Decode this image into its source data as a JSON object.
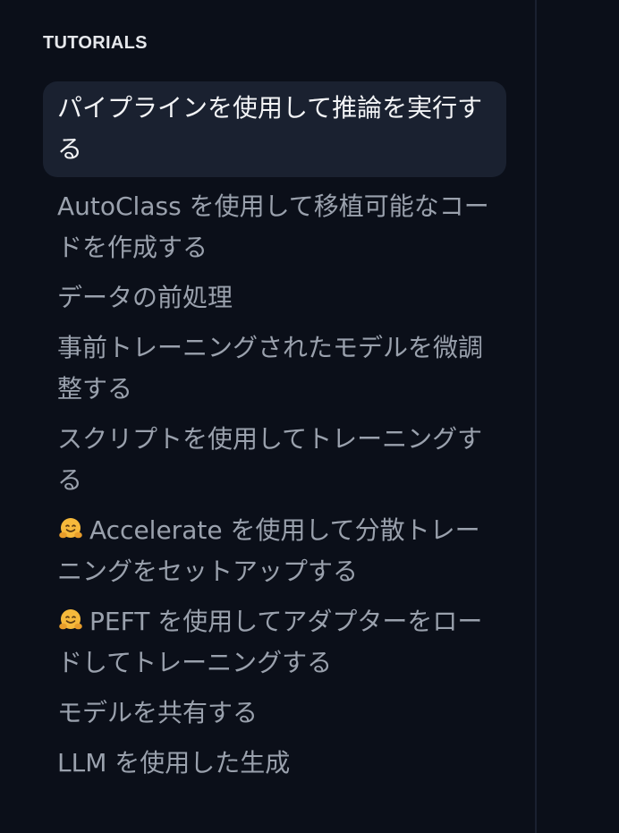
{
  "sidebar": {
    "section_title": "TUTORIALS",
    "items": [
      {
        "label": "パイプラインを使用して推論を実行する",
        "active": true
      },
      {
        "label": "AutoClass を使用して移植可能なコードを作成する",
        "active": false
      },
      {
        "label": "データの前処理",
        "active": false
      },
      {
        "label": "事前トレーニングされたモデルを微調整する",
        "active": false
      },
      {
        "label": "スクリプトを使用してトレーニングする",
        "active": false
      },
      {
        "label": "Accelerate を使用して分散トレーニングをセットアップする",
        "active": false,
        "icon": "hugging-face-emoji-icon"
      },
      {
        "label": "PEFT を使用してアダプターをロードしてトレーニングする",
        "active": false,
        "icon": "hugging-face-emoji-icon"
      },
      {
        "label": "モデルを共有する",
        "active": false
      },
      {
        "label": "LLM を使用した生成",
        "active": false
      }
    ]
  },
  "colors": {
    "background": "#0b0f19",
    "active_item_background": "#1a2130",
    "active_text": "#f3f4f6",
    "inactive_text": "#9aa1ad",
    "title_text": "#e5e7eb",
    "emoji": "#f6b93b"
  }
}
